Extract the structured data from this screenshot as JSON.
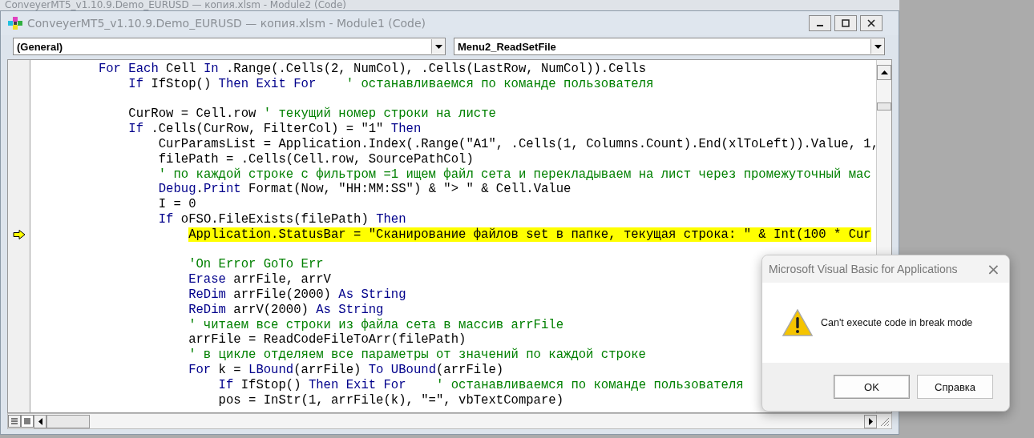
{
  "back_window": {
    "title": "ConveyerMT5_v1.10.9.Demo_EURUSD — копия.xlsm - Module2 (Code)"
  },
  "window": {
    "title": "ConveyerMT5_v1.10.9.Demo_EURUSD — копия.xlsm - Module1 (Code)",
    "active": false
  },
  "object_combo": {
    "value": "(General)"
  },
  "procedure_combo": {
    "value": "Menu2_ReadSetFile"
  },
  "code_lines": [
    {
      "current": false,
      "segments": [
        {
          "kind": "keyword",
          "text": "        For Each"
        },
        {
          "kind": "plain",
          "text": " Cell "
        },
        {
          "kind": "keyword",
          "text": "In"
        },
        {
          "kind": "plain",
          "text": " .Range(.Cells(2, NumCol), .Cells(LastRow, NumCol)).Cells"
        }
      ]
    },
    {
      "current": false,
      "segments": [
        {
          "kind": "keyword",
          "text": "            If"
        },
        {
          "kind": "plain",
          "text": " IfStop() "
        },
        {
          "kind": "keyword",
          "text": "Then Exit For"
        },
        {
          "kind": "comment",
          "text": "    ' останавливаемся по команде пользователя"
        }
      ]
    },
    {
      "current": false
    },
    {
      "current": false,
      "segments": [
        {
          "kind": "plain",
          "text": "            CurRow = Cell.row "
        },
        {
          "kind": "comment",
          "text": "' текущий номер строки на листе"
        }
      ]
    },
    {
      "current": false,
      "segments": [
        {
          "kind": "keyword",
          "text": "            If"
        },
        {
          "kind": "plain",
          "text": " .Cells(CurRow, FilterCol) = \"1\" "
        },
        {
          "kind": "keyword",
          "text": "Then"
        }
      ]
    },
    {
      "current": false,
      "segments": [
        {
          "kind": "plain",
          "text": "                CurParamsList = Application.Index(.Range(\"A1\", .Cells(1, Columns.Count).End(xlToLeft)).Value, 1,"
        }
      ]
    },
    {
      "current": false,
      "segments": [
        {
          "kind": "plain",
          "text": "                filePath = .Cells(Cell.row, SourcePathCol)"
        }
      ]
    },
    {
      "current": false,
      "segments": [
        {
          "kind": "comment",
          "text": "                ' по каждой строке с фильтром =1 ищем файл сета и перекладываем на лист через промежуточный мас"
        }
      ]
    },
    {
      "current": false,
      "segments": [
        {
          "kind": "keyword",
          "text": "                Debug"
        },
        {
          "kind": "plain",
          "text": "."
        },
        {
          "kind": "keyword",
          "text": "Print"
        },
        {
          "kind": "plain",
          "text": " Format(Now, \"HH:MM:SS\") & \"> \" & Cell.Value"
        }
      ]
    },
    {
      "current": false,
      "segments": [
        {
          "kind": "plain",
          "text": "                I = 0"
        }
      ]
    },
    {
      "current": false,
      "segments": [
        {
          "kind": "keyword",
          "text": "                If"
        },
        {
          "kind": "plain",
          "text": " oFSO.FileExists(filePath) "
        },
        {
          "kind": "keyword",
          "text": "Then"
        }
      ]
    },
    {
      "current": true,
      "segments": [
        {
          "kind": "plain",
          "text": "                    Application.StatusBar = \"Сканирование файлов set в папке, текущая строка: \" & Int(100 * Cur"
        }
      ]
    },
    {
      "current": false
    },
    {
      "current": false,
      "segments": [
        {
          "kind": "comment",
          "text": "                    'On Error GoTo Err"
        }
      ]
    },
    {
      "current": false,
      "segments": [
        {
          "kind": "keyword",
          "text": "                    Erase"
        },
        {
          "kind": "plain",
          "text": " arrFile, arrV"
        }
      ]
    },
    {
      "current": false,
      "segments": [
        {
          "kind": "keyword",
          "text": "                    ReDim"
        },
        {
          "kind": "plain",
          "text": " arrFile(2000) "
        },
        {
          "kind": "keyword",
          "text": "As String"
        }
      ]
    },
    {
      "current": false,
      "segments": [
        {
          "kind": "keyword",
          "text": "                    ReDim"
        },
        {
          "kind": "plain",
          "text": " arrV(2000) "
        },
        {
          "kind": "keyword",
          "text": "As String"
        }
      ]
    },
    {
      "current": false,
      "segments": [
        {
          "kind": "comment",
          "text": "                    ' читаем все строки из файла сета в массив arrFile"
        }
      ]
    },
    {
      "current": false,
      "segments": [
        {
          "kind": "plain",
          "text": "                    arrFile = ReadCodeFileToArr(filePath)"
        }
      ]
    },
    {
      "current": false,
      "segments": [
        {
          "kind": "comment",
          "text": "                    ' в цикле отделяем все параметры от значений по каждой строке"
        }
      ]
    },
    {
      "current": false,
      "segments": [
        {
          "kind": "keyword",
          "text": "                    For"
        },
        {
          "kind": "plain",
          "text": " k = "
        },
        {
          "kind": "keyword",
          "text": "LBound"
        },
        {
          "kind": "plain",
          "text": "(arrFile) "
        },
        {
          "kind": "keyword",
          "text": "To"
        },
        {
          "kind": "keyword",
          "text": " UBound"
        },
        {
          "kind": "plain",
          "text": "(arrFile)"
        }
      ]
    },
    {
      "current": false,
      "segments": [
        {
          "kind": "keyword",
          "text": "                        If"
        },
        {
          "kind": "plain",
          "text": " IfStop() "
        },
        {
          "kind": "keyword",
          "text": "Then Exit For"
        },
        {
          "kind": "comment",
          "text": "    ' останавливаемся по команде пользователя"
        }
      ]
    },
    {
      "current": false,
      "segments": [
        {
          "kind": "plain",
          "text": "                        pos = InStr(1, arrFile(k), \"=\", vbTextCompare)"
        }
      ]
    }
  ],
  "dialog": {
    "title": "Microsoft Visual Basic for Applications",
    "close": "×",
    "message": "Can't execute code in break mode",
    "buttons": [
      {
        "label": "OK",
        "selected": true
      },
      {
        "label": "Справка",
        "selected": false
      }
    ]
  }
}
